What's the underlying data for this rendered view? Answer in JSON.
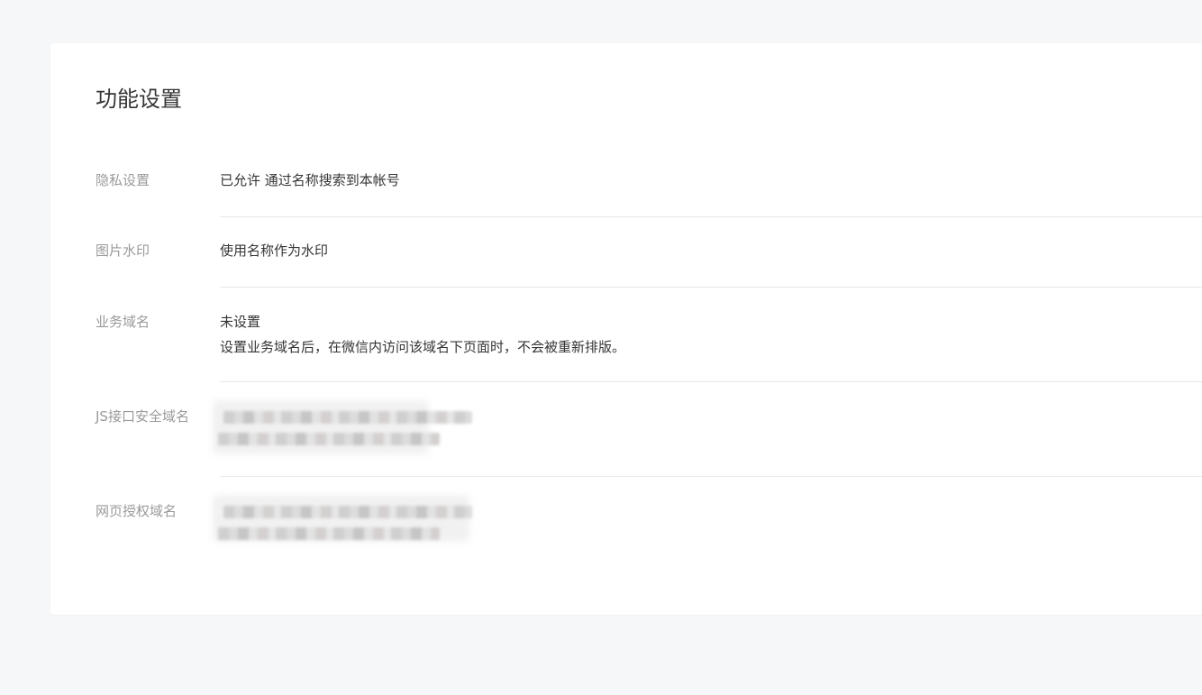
{
  "card": {
    "title": "功能设置"
  },
  "settings": [
    {
      "label": "隐私设置",
      "value": "已允许 通过名称搜索到本帐号"
    },
    {
      "label": "图片水印",
      "value": "使用名称作为水印"
    },
    {
      "label": "业务域名",
      "value": "未设置",
      "description": "设置业务域名后，在微信内访问该域名下页面时，不会被重新排版。"
    },
    {
      "label": "JS接口安全域名",
      "value_state": "blurred"
    },
    {
      "label": "网页授权域名",
      "value_state": "blurred"
    }
  ],
  "colors": {
    "background": "#f6f7f9",
    "card": "#ffffff",
    "label": "#9a9a9a",
    "text": "#353535",
    "divider": "#e7e7eb"
  }
}
